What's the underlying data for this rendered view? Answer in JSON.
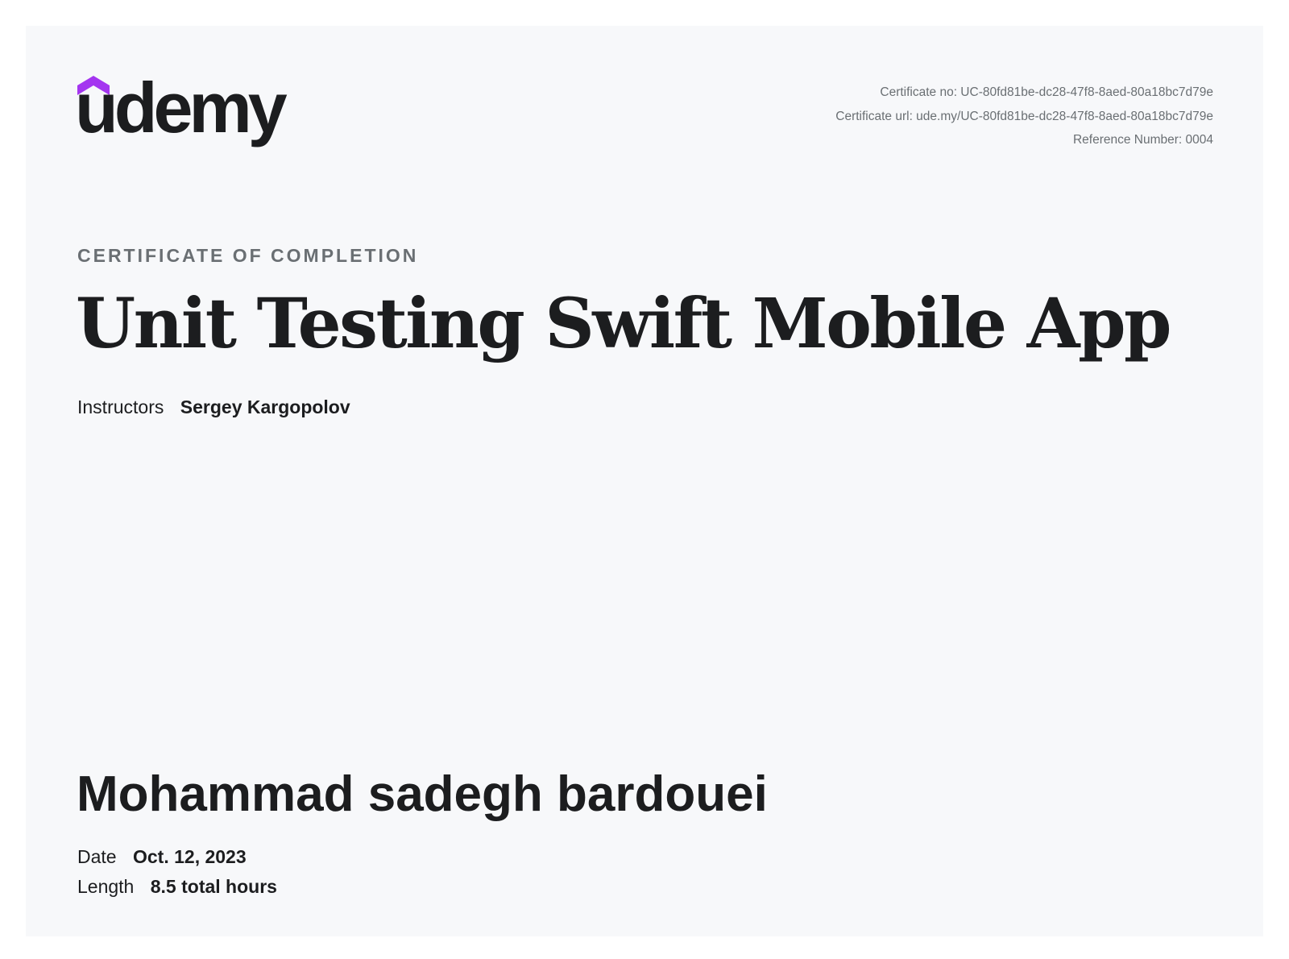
{
  "brand": {
    "name": "udemy",
    "accent_color": "#a435f0",
    "text_color": "#1c1d1f",
    "logo_icon": "udemy-chevron-icon"
  },
  "certificate": {
    "number_line": "Certificate no: UC-80fd81be-dc28-47f8-8aed-80a18bc7d79e",
    "url_line": "Certificate url: ude.my/UC-80fd81be-dc28-47f8-8aed-80a18bc7d79e",
    "reference_line": "Reference Number: 0004",
    "heading": "CERTIFICATE OF COMPLETION",
    "course_title": "Unit Testing Swift Mobile App",
    "instructors_label": "Instructors",
    "instructors_value": "Sergey Kargopolov",
    "recipient_name": "Mohammad sadegh bardouei",
    "date_label": "Date",
    "date_value": "Oct. 12, 2023",
    "length_label": "Length",
    "length_value": "8.5 total hours"
  }
}
